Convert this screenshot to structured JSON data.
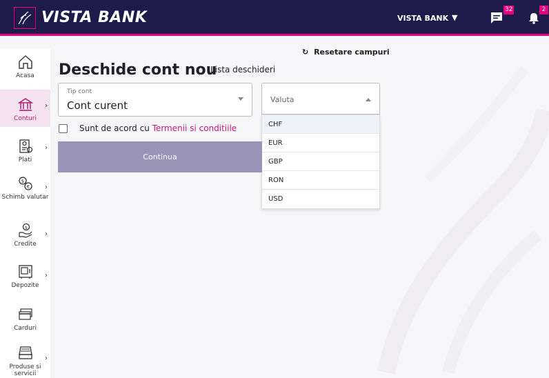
{
  "header": {
    "brand": "VISTA BANK",
    "user_name": "VISTA BANK",
    "messages_count": "32",
    "notifications_count": "2"
  },
  "sidebar": {
    "items": [
      {
        "label": "Acasa",
        "icon": "home-icon"
      },
      {
        "label": "Conturi",
        "icon": "bank-icon"
      },
      {
        "label": "Plati",
        "icon": "payment-icon"
      },
      {
        "label": "Schimb valutar",
        "icon": "exchange-icon"
      },
      {
        "label": "Credite",
        "icon": "credit-icon"
      },
      {
        "label": "Depozite",
        "icon": "safe-icon"
      },
      {
        "label": "Carduri",
        "icon": "card-icon"
      },
      {
        "label": "Produse si servicii",
        "icon": "products-icon"
      }
    ]
  },
  "main": {
    "reset_label": "Resetare campuri",
    "title": "Deschide cont nou",
    "list_link": "Lista deschideri",
    "tip_cont": {
      "label": "Tip cont",
      "value": "Cont curent"
    },
    "valuta": {
      "placeholder": "Valuta",
      "options": [
        "CHF",
        "EUR",
        "GBP",
        "RON",
        "USD"
      ]
    },
    "terms_prefix": "Sunt de acord cu ",
    "terms_link": "Termenii si conditiile",
    "continue_label": "Continua"
  },
  "colors": {
    "header_bg": "#1e1a4a",
    "accent": "#e6007e",
    "button": "#9a94b8"
  }
}
